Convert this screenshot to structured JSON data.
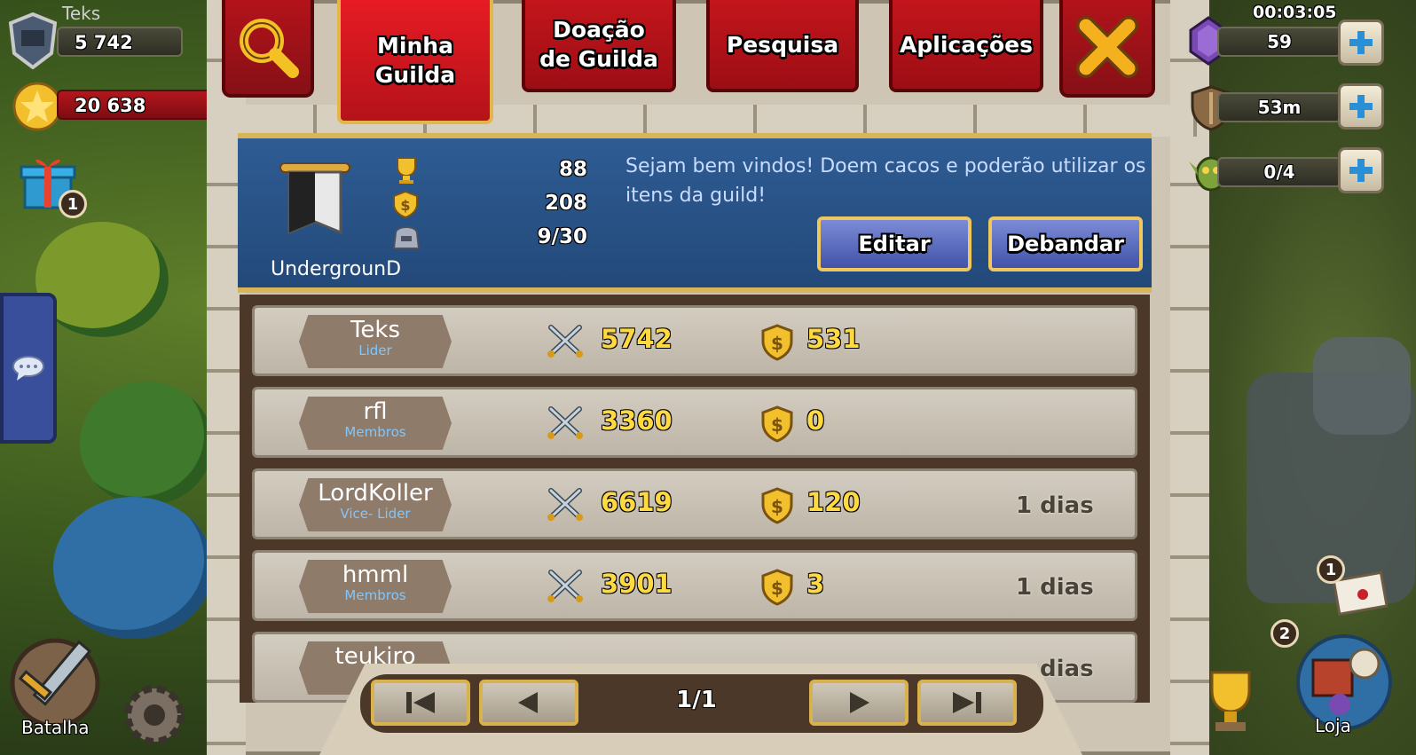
{
  "hud": {
    "player_name": "Teks",
    "power": "5 742",
    "gold": "20 638",
    "gift_count": "1",
    "timer": "00:03:05",
    "gems": "59",
    "shield": "53m",
    "goblins": "0/4",
    "battle_label": "Batalha",
    "shop_label": "Loja",
    "mail_count": "1",
    "shop_count": "2"
  },
  "tabs": [
    {
      "label": "Minha Guilda"
    },
    {
      "label": "Doação de Guilda"
    },
    {
      "label": "Pesquisa"
    },
    {
      "label": "Aplicações"
    }
  ],
  "guild": {
    "name": "UndergrounD",
    "trophies": "88",
    "funds": "208",
    "members": "9/30",
    "description": "Sejam bem vindos! Doem cacos e poderão utilizar os itens da guild!",
    "edit_label": "Editar",
    "disband_label": "Debandar"
  },
  "members": [
    {
      "name": "Teks",
      "role": "Lider",
      "power": "5742",
      "donation": "531",
      "last": ""
    },
    {
      "name": "rfl",
      "role": "Membros",
      "power": "3360",
      "donation": "0",
      "last": ""
    },
    {
      "name": "LordKoller",
      "role": "Vice- Lider",
      "power": "6619",
      "donation": "120",
      "last": "1 dias"
    },
    {
      "name": "hmml",
      "role": "Membros",
      "power": "3901",
      "donation": "3",
      "last": "1 dias"
    },
    {
      "name": "teukiro",
      "role": "",
      "power": "",
      "donation": "",
      "last": "dias"
    }
  ],
  "pager": {
    "page": "1/1"
  }
}
